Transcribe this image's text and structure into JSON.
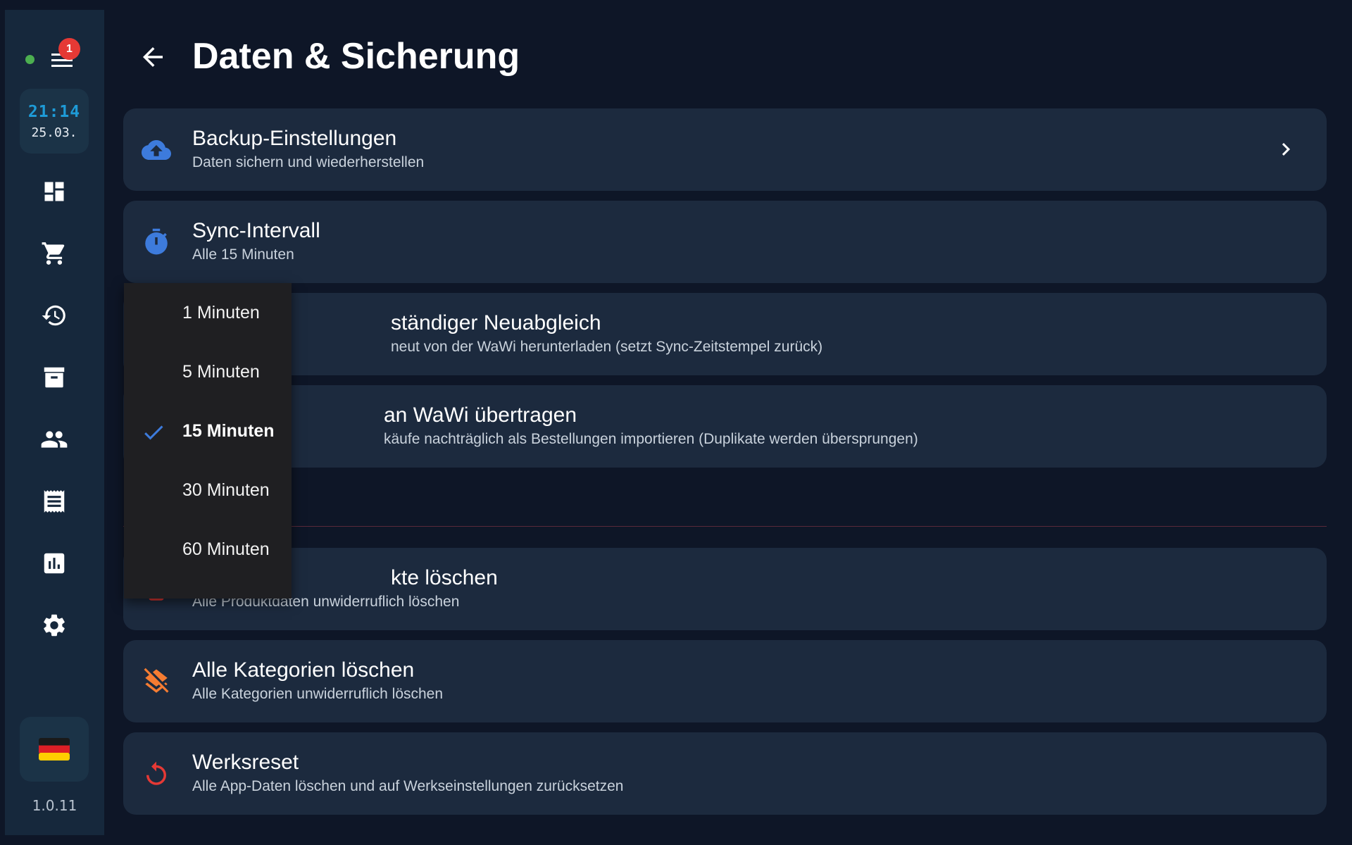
{
  "sidebar": {
    "notification_count": "1",
    "clock_time": "21:14",
    "clock_date": "25.03.",
    "nav_items": [
      "dashboard-icon",
      "cart-icon",
      "history-icon",
      "archive-icon",
      "people-icon",
      "receipt-icon",
      "chart-icon",
      "settings-icon"
    ],
    "language_flag": "🇩🇪",
    "version": "1.0.11"
  },
  "header": {
    "title": "Daten & Sicherung"
  },
  "cards": {
    "backup": {
      "title": "Backup-Einstellungen",
      "subtitle": "Daten sichern und wiederherstellen"
    },
    "sync": {
      "title": "Sync-Intervall",
      "subtitle": "Alle 15 Minuten"
    },
    "resync": {
      "title": "ständiger Neuabgleich",
      "subtitle": "neut von der WaWi herunterladen (setzt Sync-Zeitstempel zurück)"
    },
    "transfer": {
      "title": "an WaWi übertragen",
      "subtitle": "käufe nachträglich als Bestellungen importieren (Duplikate werden übersprungen)"
    },
    "delete_products": {
      "title": "kte löschen",
      "subtitle": "Alle Produktdaten unwiderruflich löschen"
    },
    "delete_categories": {
      "title": "Alle Kategorien löschen",
      "subtitle": "Alle Kategorien unwiderruflich löschen"
    },
    "factory_reset": {
      "title": "Werksreset",
      "subtitle": "Alle App-Daten löschen und auf Werkseinstellungen zurücksetzen"
    }
  },
  "dropdown": {
    "options": [
      "1 Minuten",
      "5 Minuten",
      "15 Minuten",
      "30 Minuten",
      "60 Minuten"
    ],
    "selected": "15 Minuten"
  },
  "colors": {
    "background": "#0e1627",
    "sidebar": "#16283c",
    "card": "#1c2a3e",
    "accent_blue": "#3d7bdc",
    "clock_blue": "#1e9bd7",
    "danger_red": "#e53935",
    "warning_orange": "#f57c32",
    "online_green": "#4caf50",
    "dropdown_bg": "#1f1f22"
  }
}
